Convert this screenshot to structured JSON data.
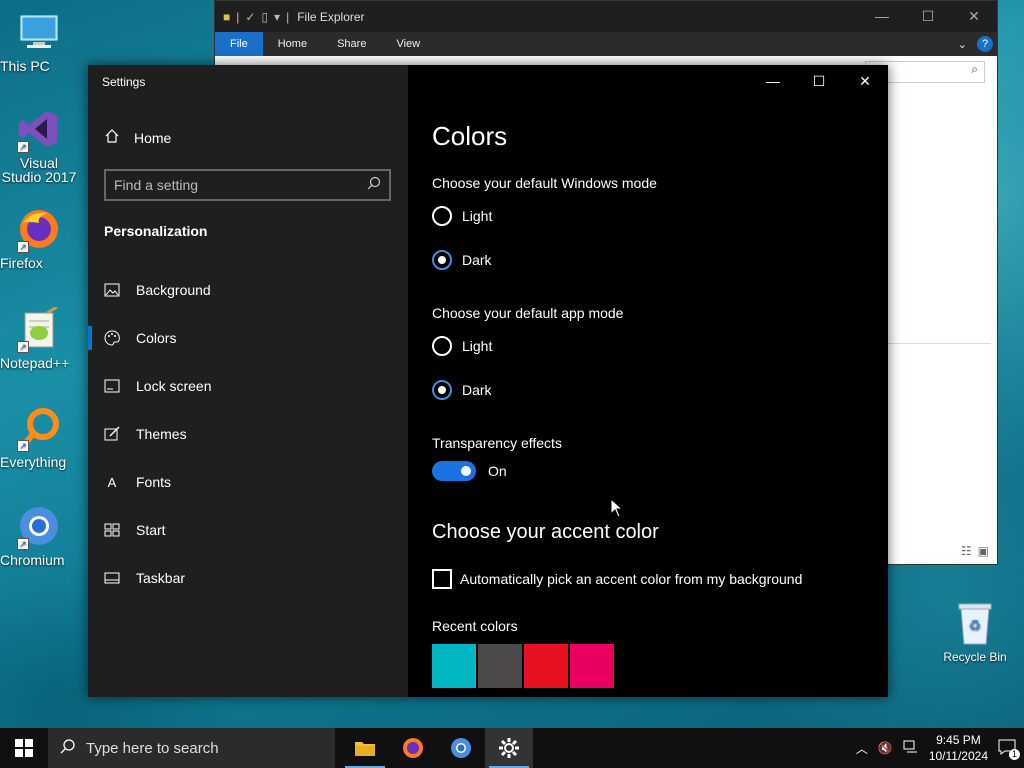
{
  "desktop": {
    "icons": [
      {
        "label": "This PC",
        "icon": "computer-icon"
      },
      {
        "label": "Visual Studio 2017",
        "icon": "visual-studio-icon"
      },
      {
        "label": "Firefox",
        "icon": "firefox-icon"
      },
      {
        "label": "Notepad++",
        "icon": "notepad-plus-plus-icon"
      },
      {
        "label": "Everything",
        "icon": "everything-search-icon"
      },
      {
        "label": "Chromium",
        "icon": "chromium-icon"
      }
    ],
    "recycle_bin": "Recycle Bin"
  },
  "explorer": {
    "title": "File Explorer",
    "tabs": [
      "File",
      "Home",
      "Share",
      "View"
    ],
    "help": "?",
    "search_icon": "search-icon"
  },
  "settings": {
    "app_title": "Settings",
    "home": "Home",
    "search_placeholder": "Find a setting",
    "section": "Personalization",
    "nav_items": [
      {
        "label": "Background",
        "icon": "picture-icon"
      },
      {
        "label": "Colors",
        "icon": "palette-icon",
        "active": true
      },
      {
        "label": "Lock screen",
        "icon": "lock-screen-icon"
      },
      {
        "label": "Themes",
        "icon": "brush-icon"
      },
      {
        "label": "Fonts",
        "icon": "font-icon"
      },
      {
        "label": "Start",
        "icon": "start-tiles-icon"
      },
      {
        "label": "Taskbar",
        "icon": "taskbar-icon"
      }
    ],
    "page_title": "Colors",
    "windows_mode": {
      "label": "Choose your default Windows mode",
      "options": [
        "Light",
        "Dark"
      ],
      "selected": "Dark"
    },
    "app_mode": {
      "label": "Choose your default app mode",
      "options": [
        "Light",
        "Dark"
      ],
      "selected": "Dark"
    },
    "transparency": {
      "label": "Transparency effects",
      "state": "On"
    },
    "accent_heading": "Choose your accent color",
    "auto_accent": "Automatically pick an accent color from my background",
    "recent_colors_label": "Recent colors",
    "recent_colors": [
      "#00b7c3",
      "#4c4a48",
      "#e81123",
      "#ea005e"
    ]
  },
  "taskbar": {
    "search_placeholder": "Type here to search",
    "time": "9:45 PM",
    "date": "10/11/2024",
    "notification_count": "1"
  },
  "colors": {
    "accent": "#0078d7",
    "nav_bg": "#1f1f1f",
    "content_bg": "#000000"
  }
}
